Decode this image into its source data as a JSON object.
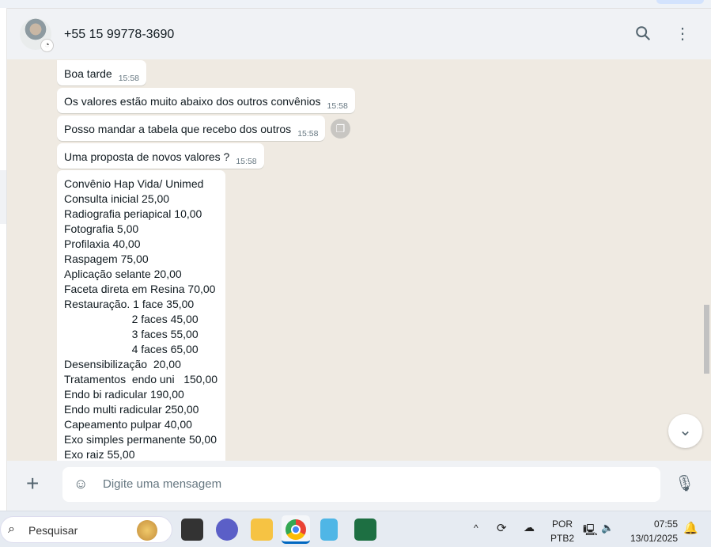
{
  "header": {
    "contact": "+55 15 99778-3690"
  },
  "messages": [
    {
      "text": "Boa tarde",
      "time": "15:58"
    },
    {
      "text": "Os valores estão muito abaixo dos outros convênios",
      "time": "15:58"
    },
    {
      "text": "Posso mandar a tabela que recebo dos outros",
      "time": "15:58"
    },
    {
      "text": "Uma proposta de novos valores ?",
      "time": "15:58"
    }
  ],
  "long_message": "Convênio Hap Vida/ Unimed\nConsulta inicial 25,00\nRadiografia periapical 10,00\nFotografia 5,00\nProfilaxia 40,00\nRaspagem 75,00\nAplicação selante 20,00\nFaceta direta em Resina 70,00\nRestauração. 1 face 35,00\n                      2 faces 45,00\n                      3 faces 55,00\n                      4 faces 65,00\nDesensibilização  20,00\nTratamentos  endo uni   150,00\nEndo bi radicular 190,00\nEndo multi radicular 250,00\nCapeamento pulpar 40,00\nExo simples permanente 50,00\nExo raiz 55,00",
  "composer": {
    "placeholder": "Digite uma mensagem"
  },
  "taskbar": {
    "search": "Pesquisar",
    "lang1": "POR",
    "lang2": "PTB2",
    "time": "07:55",
    "date": "13/01/2025"
  }
}
